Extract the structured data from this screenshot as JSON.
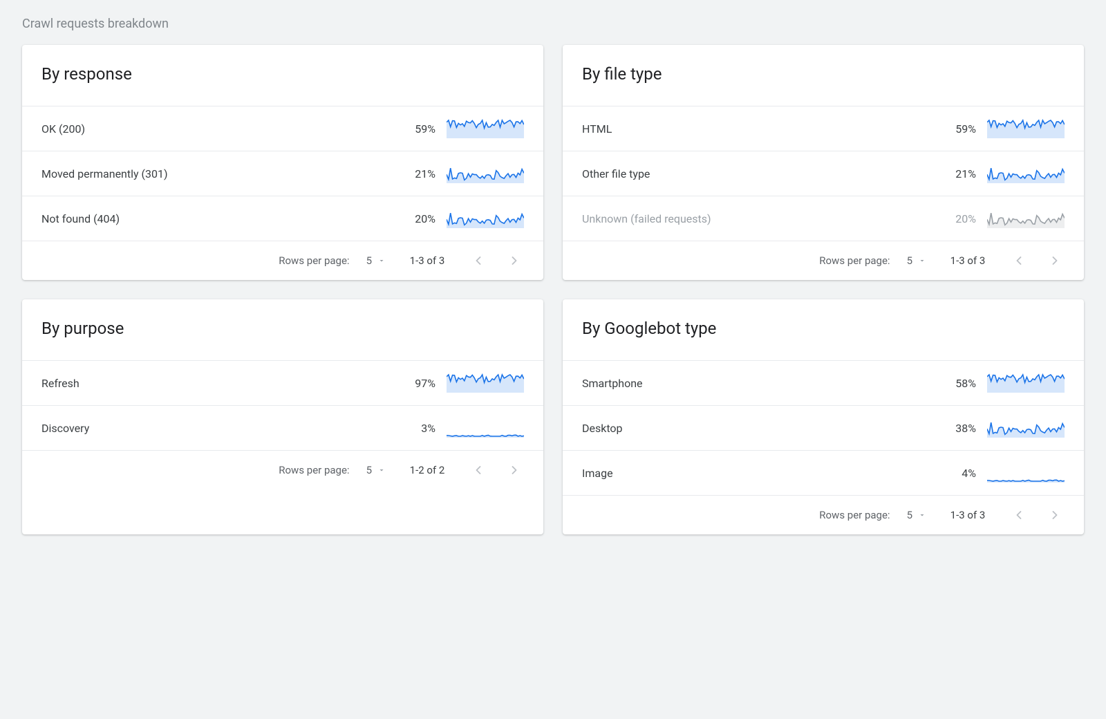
{
  "section_title": "Crawl requests breakdown",
  "colors": {
    "spark_blue": "#1a73e8",
    "spark_gray": "#9aa0a6"
  },
  "pagination_labels": {
    "rows_per_page": "Rows per page:"
  },
  "cards": [
    {
      "id": "by-response",
      "title": "By response",
      "rows": [
        {
          "label": "OK (200)",
          "pct": "59%",
          "spark": "high",
          "muted": false
        },
        {
          "label": "Moved permanently (301)",
          "pct": "21%",
          "spark": "mid",
          "muted": false
        },
        {
          "label": "Not found (404)",
          "pct": "20%",
          "spark": "mid",
          "muted": false
        }
      ],
      "pager": {
        "page_size": "5",
        "range": "1-3 of 3"
      }
    },
    {
      "id": "by-file-type",
      "title": "By file type",
      "rows": [
        {
          "label": "HTML",
          "pct": "59%",
          "spark": "high",
          "muted": false
        },
        {
          "label": "Other file type",
          "pct": "21%",
          "spark": "mid",
          "muted": false
        },
        {
          "label": "Unknown (failed requests)",
          "pct": "20%",
          "spark": "mid",
          "muted": true
        }
      ],
      "pager": {
        "page_size": "5",
        "range": "1-3 of 3"
      }
    },
    {
      "id": "by-purpose",
      "title": "By purpose",
      "rows": [
        {
          "label": "Refresh",
          "pct": "97%",
          "spark": "high",
          "muted": false
        },
        {
          "label": "Discovery",
          "pct": "3%",
          "spark": "low",
          "muted": false
        }
      ],
      "pager": {
        "page_size": "5",
        "range": "1-2 of 2"
      }
    },
    {
      "id": "by-googlebot-type",
      "title": "By Googlebot type",
      "rows": [
        {
          "label": "Smartphone",
          "pct": "58%",
          "spark": "high",
          "muted": false
        },
        {
          "label": "Desktop",
          "pct": "38%",
          "spark": "mid",
          "muted": false
        },
        {
          "label": "Image",
          "pct": "4%",
          "spark": "low",
          "muted": false
        }
      ],
      "pager": {
        "page_size": "5",
        "range": "1-3 of 3"
      }
    }
  ]
}
